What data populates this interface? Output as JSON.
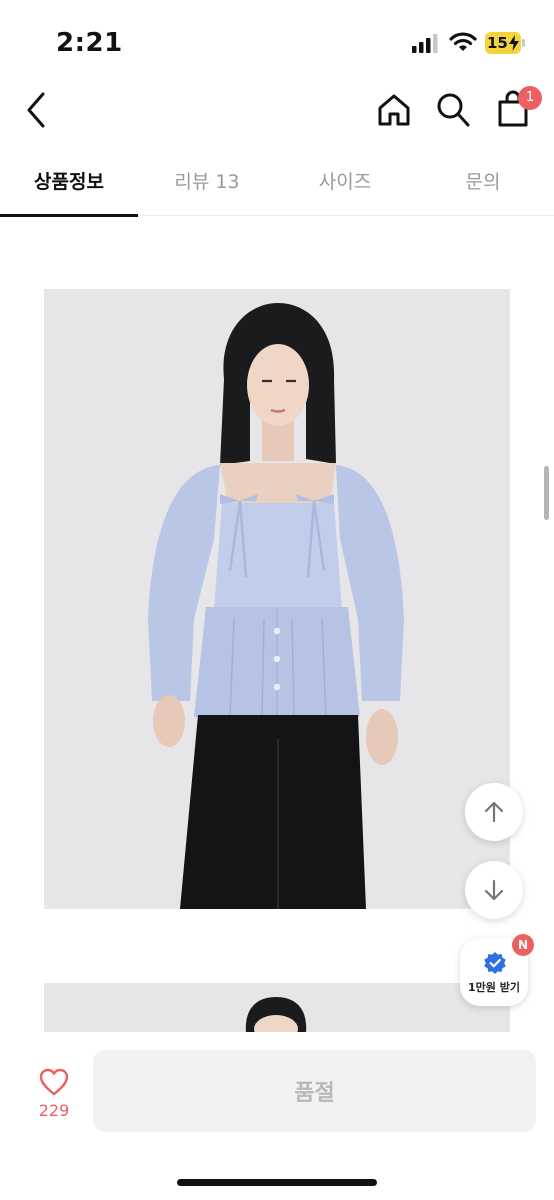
{
  "status": {
    "time": "2:21",
    "battery": "15"
  },
  "header": {
    "cart_count": "1"
  },
  "tabs": [
    {
      "label": "상품정보",
      "active": true
    },
    {
      "label": "리뷰 13",
      "active": false
    },
    {
      "label": "사이즈",
      "active": false
    },
    {
      "label": "문의",
      "active": false
    }
  ],
  "floating": {
    "reward_label": "1만원 받기",
    "reward_badge": "N"
  },
  "bottom": {
    "like_count": "229",
    "button_label": "품절"
  },
  "colors": {
    "accent": "#ee5f62",
    "battery": "#f5d33a",
    "blouse": "#b9c6e6"
  }
}
